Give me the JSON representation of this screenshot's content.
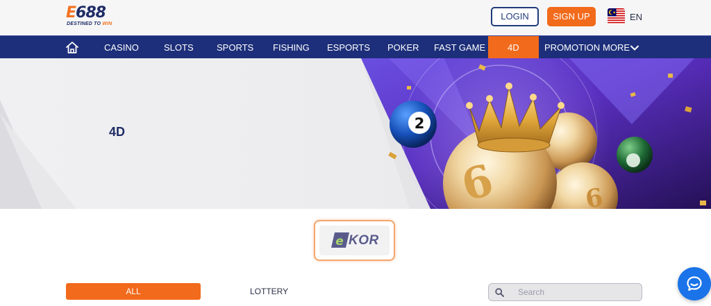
{
  "header": {
    "logo_text_prefix": "E",
    "logo_text_main": "688",
    "logo_tagline_prefix": "DESTINED TO ",
    "logo_tagline_accent": "WIN",
    "login_label": "LOGIN",
    "signup_label": "SIGN UP",
    "language": "EN",
    "flag_icon": "malaysia-flag-icon"
  },
  "nav": {
    "home_icon": "home-icon",
    "items": [
      {
        "label": "CASINO"
      },
      {
        "label": "SLOTS"
      },
      {
        "label": "SPORTS"
      },
      {
        "label": "FISHING"
      },
      {
        "label": "ESPORTS"
      },
      {
        "label": "POKER"
      },
      {
        "label": "FAST GAME"
      },
      {
        "label": "4D",
        "active": true
      },
      {
        "label": "PROMOTION"
      },
      {
        "label": "MORE"
      }
    ],
    "more_icon": "chevron-down-icon"
  },
  "banner": {
    "title": "4D",
    "ball_numbers": [
      "2",
      "6",
      "6",
      "6"
    ]
  },
  "provider": {
    "logo_letter": "e",
    "logo_text": "KOR"
  },
  "filters": {
    "tabs": [
      {
        "label": "ALL",
        "active": true
      },
      {
        "label": "LOTTERY",
        "active": false
      }
    ],
    "search_placeholder": "Search"
  },
  "colors": {
    "brand_navy": "#1d2f7a",
    "accent_orange": "#f26a1b",
    "chat_blue": "#1a73e8"
  }
}
